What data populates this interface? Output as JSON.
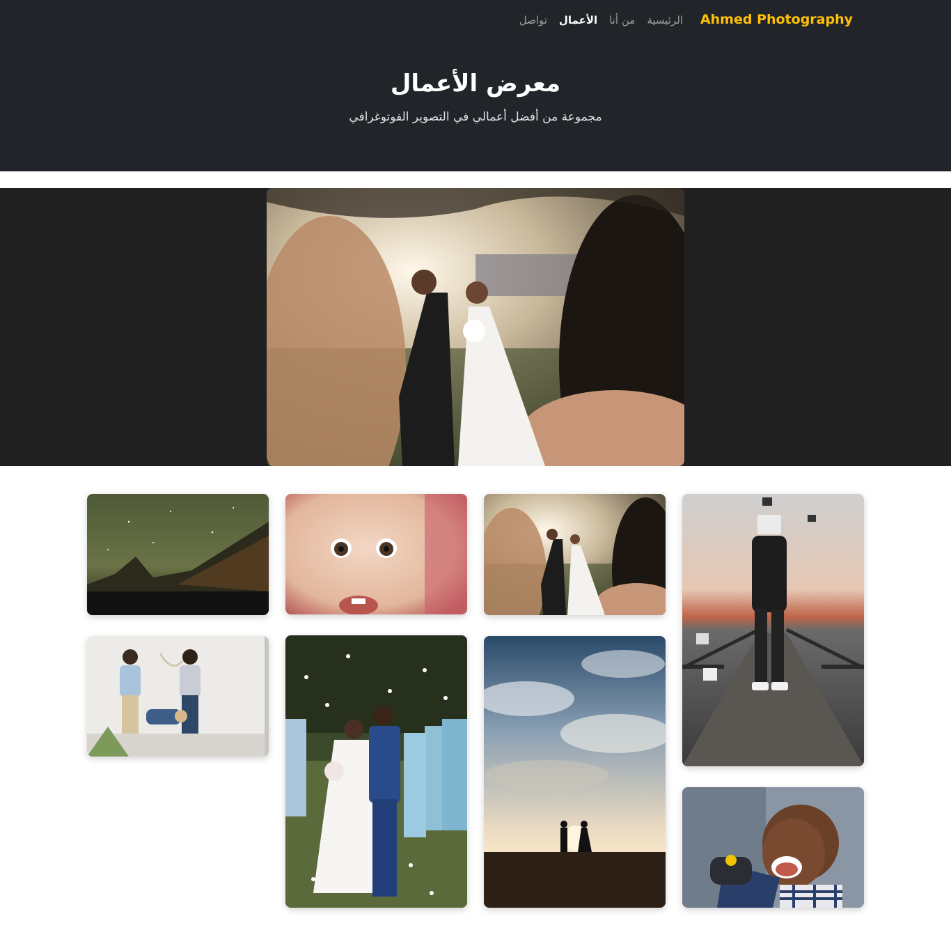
{
  "brand": "Ahmed Photography",
  "nav": {
    "home": "الرئيسية",
    "about": "من أنا",
    "works": "الأعمال",
    "contact": "تواصل"
  },
  "hero": {
    "title": "معرض الأعمال",
    "subtitle": "مجموعة من أفضل أعمالي في التصوير الفوتوغرافي"
  },
  "colors": {
    "brand": "#ffc107",
    "header_bg": "#212529",
    "feature_bg": "#202020"
  },
  "featured_photo": {
    "subject": "wedding-procession"
  },
  "gallery": [
    {
      "subject": "night-sky-mountains"
    },
    {
      "subject": "baby-closeup"
    },
    {
      "subject": "wedding-procession"
    },
    {
      "subject": "masked-man-on-pier"
    },
    {
      "subject": "family-playing"
    },
    {
      "subject": "wedding-kiss-petals"
    },
    {
      "subject": "couple-silhouette-sunset"
    },
    {
      "subject": "laughing-child"
    }
  ]
}
